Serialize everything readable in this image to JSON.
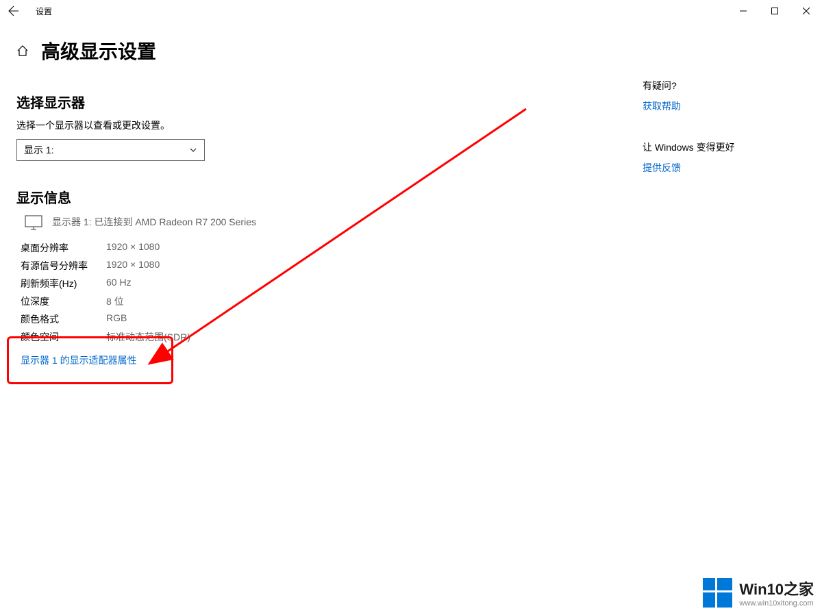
{
  "window": {
    "title": "设置"
  },
  "header": {
    "page_title": "高级显示设置"
  },
  "display_selector": {
    "section_title": "选择显示器",
    "description": "选择一个显示器以查看或更改设置。",
    "selected": "显示 1:"
  },
  "display_info": {
    "section_title": "显示信息",
    "connected_text": "显示器 1: 已连接到 AMD Radeon R7 200 Series",
    "rows": [
      {
        "label": "桌面分辨率",
        "value": "1920 × 1080"
      },
      {
        "label": "有源信号分辨率",
        "value": "1920 × 1080"
      },
      {
        "label": "刷新频率(Hz)",
        "value": "60 Hz"
      },
      {
        "label": "位深度",
        "value": "8 位"
      },
      {
        "label": "颜色格式",
        "value": "RGB"
      },
      {
        "label": "颜色空间",
        "value": "标准动态范围(SDR)"
      }
    ],
    "adapter_link": "显示器 1 的显示适配器属性"
  },
  "sidebar": {
    "help": {
      "title": "有疑问?",
      "link": "获取帮助"
    },
    "feedback": {
      "title": "让 Windows 变得更好",
      "link": "提供反馈"
    }
  },
  "watermark": {
    "title": "Win10之家",
    "url": "www.win10xitong.com"
  }
}
